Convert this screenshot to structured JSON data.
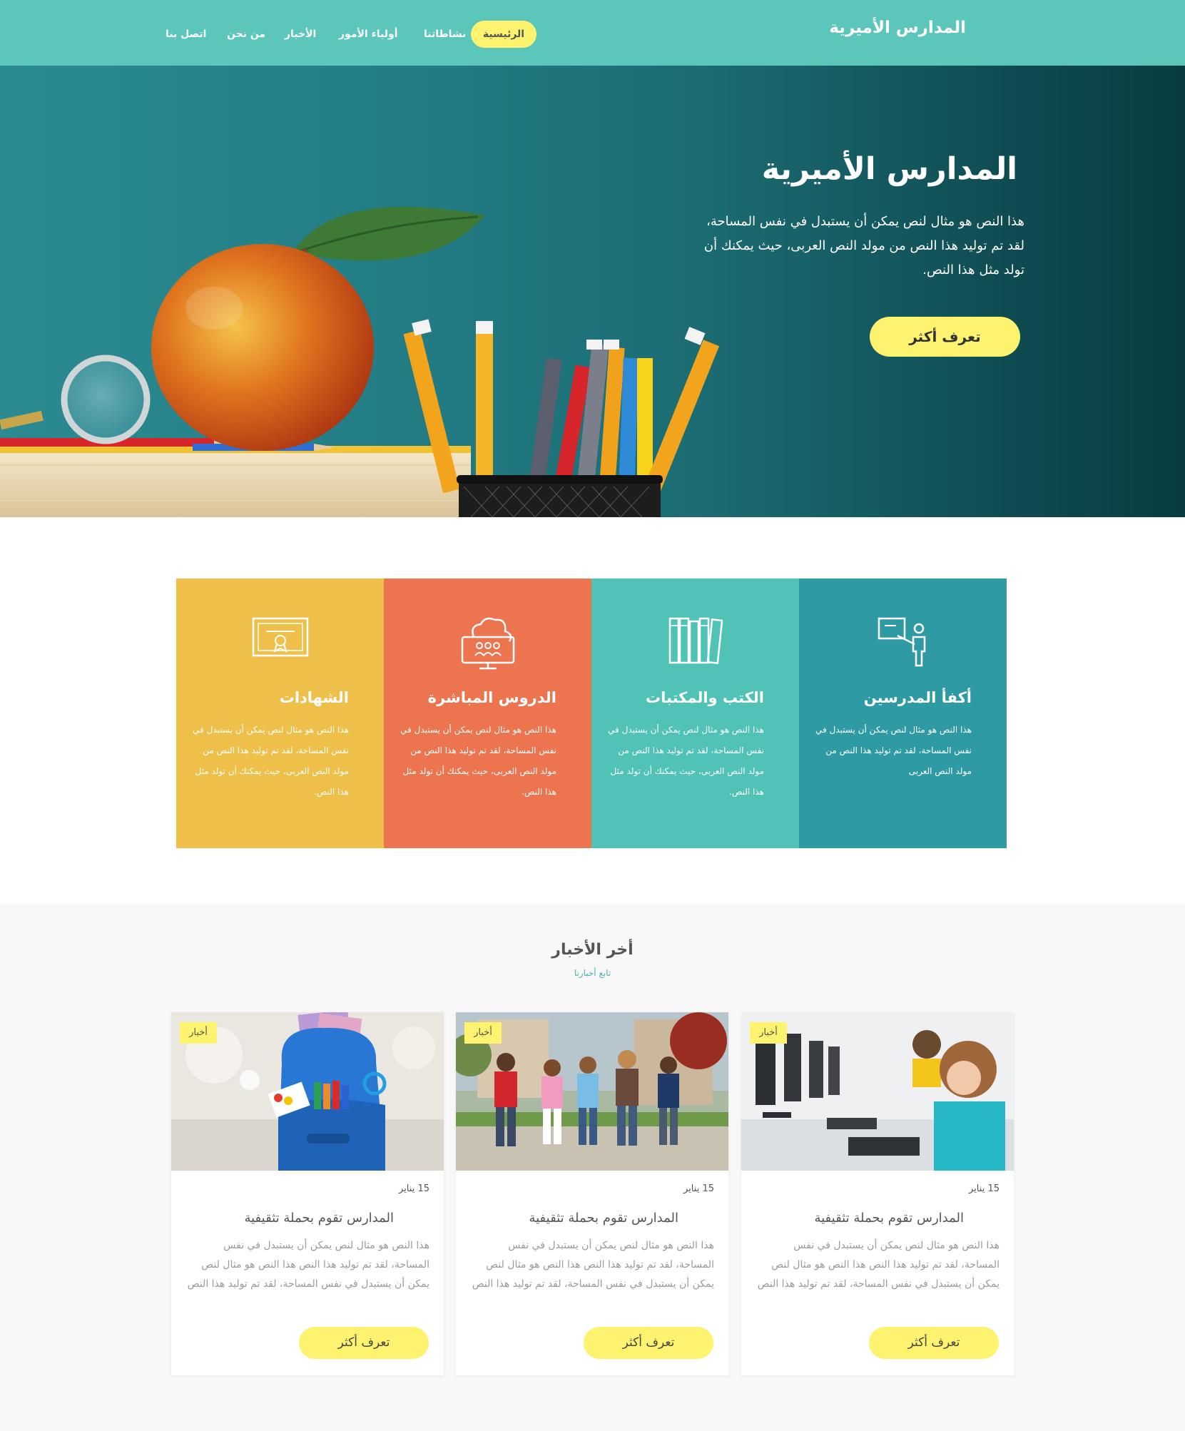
{
  "header": {
    "brand": "المدارس الأميرية",
    "nav": [
      {
        "label": "الرئيسية"
      },
      {
        "label": "نشاطاتنا"
      },
      {
        "label": "أولياء الأمور"
      },
      {
        "label": "الأخبار"
      },
      {
        "label": "من نحن"
      },
      {
        "label": "اتصل بنا"
      }
    ]
  },
  "hero": {
    "title": "المدارس الأميرية",
    "text": "هذا النص هو مثال لنص يمكن أن يستبدل في نفس المساحة، لقد تم توليد هذا النص من مولد النص العربى، حيث يمكنك أن تولد مثل هذا النص.",
    "button": "تعرف أكثر"
  },
  "features": [
    {
      "icon": "teacher-icon",
      "title": "أكفأ المدرسين",
      "text": "هذا النص هو مثال لنص يمكن أن يستبدل في نفس المساحة، لقد تم توليد هذا النص من مولد النص العربى",
      "color": "#2e9aa3"
    },
    {
      "icon": "books-icon",
      "title": "الكتب والمكتبات",
      "text": "هذا النص هو مثال لنص يمكن أن يستبدل في نفس المساحة، لقد تم توليد هذا النص من مولد النص العربى، حيث يمكنك أن تولد مثل هذا النص.",
      "color": "#50c2b6"
    },
    {
      "icon": "cloud-classroom-icon",
      "title": "الدروس المباشرة",
      "text": "هذا النص هو مثال لنص يمكن أن يستبدل في نفس المساحة، لقد تم توليد هذا النص من مولد النص العربى، حيث يمكنك أن تولد مثل هذا النص.",
      "color": "#ec7550"
    },
    {
      "icon": "certificate-icon",
      "title": "الشهادات",
      "text": "هذا النص هو مثال لنص يمكن أن يستبدل في نفس المساحة، لقد تم توليد هذا النص من مولد النص العربى، حيث يمكنك أن تولد مثل هذا النص.",
      "color": "#eec04a"
    }
  ],
  "news": {
    "title": "أخر الأخبار",
    "subtitle": "تابع أخبارنا",
    "items": [
      {
        "tag": "أخبار",
        "date": "15 يناير",
        "title": "المدارس تقوم بحملة تثقيفية",
        "text": "هذا النص هو مثال لنص يمكن أن يستبدل في نفس المساحة، لقد تم توليد هذا النص هذا النص هو مثال لنص يمكن أن يستبدل في نفس المساحة، لقد تم توليد هذا النص",
        "button": "تعرف أكثر",
        "image": "children-computers-image"
      },
      {
        "tag": "أخبار",
        "date": "15 يناير",
        "title": "المدارس تقوم بحملة تثقيفية",
        "text": "هذا النص هو مثال لنص يمكن أن يستبدل في نفس المساحة، لقد تم توليد هذا النص هذا النص هو مثال لنص يمكن أن يستبدل في نفس المساحة، لقد تم توليد هذا النص",
        "button": "تعرف أكثر",
        "image": "students-running-image"
      },
      {
        "tag": "أخبار",
        "date": "15 يناير",
        "title": "المدارس تقوم بحملة تثقيفية",
        "text": "هذا النص هو مثال لنص يمكن أن يستبدل في نفس المساحة، لقد تم توليد هذا النص هذا النص هو مثال لنص يمكن أن يستبدل في نفس المساحة، لقد تم توليد هذا النص",
        "button": "تعرف أكثر",
        "image": "backpack-image"
      }
    ]
  },
  "colors": {
    "header": "#5cc6bb",
    "accent": "#fef36f"
  }
}
